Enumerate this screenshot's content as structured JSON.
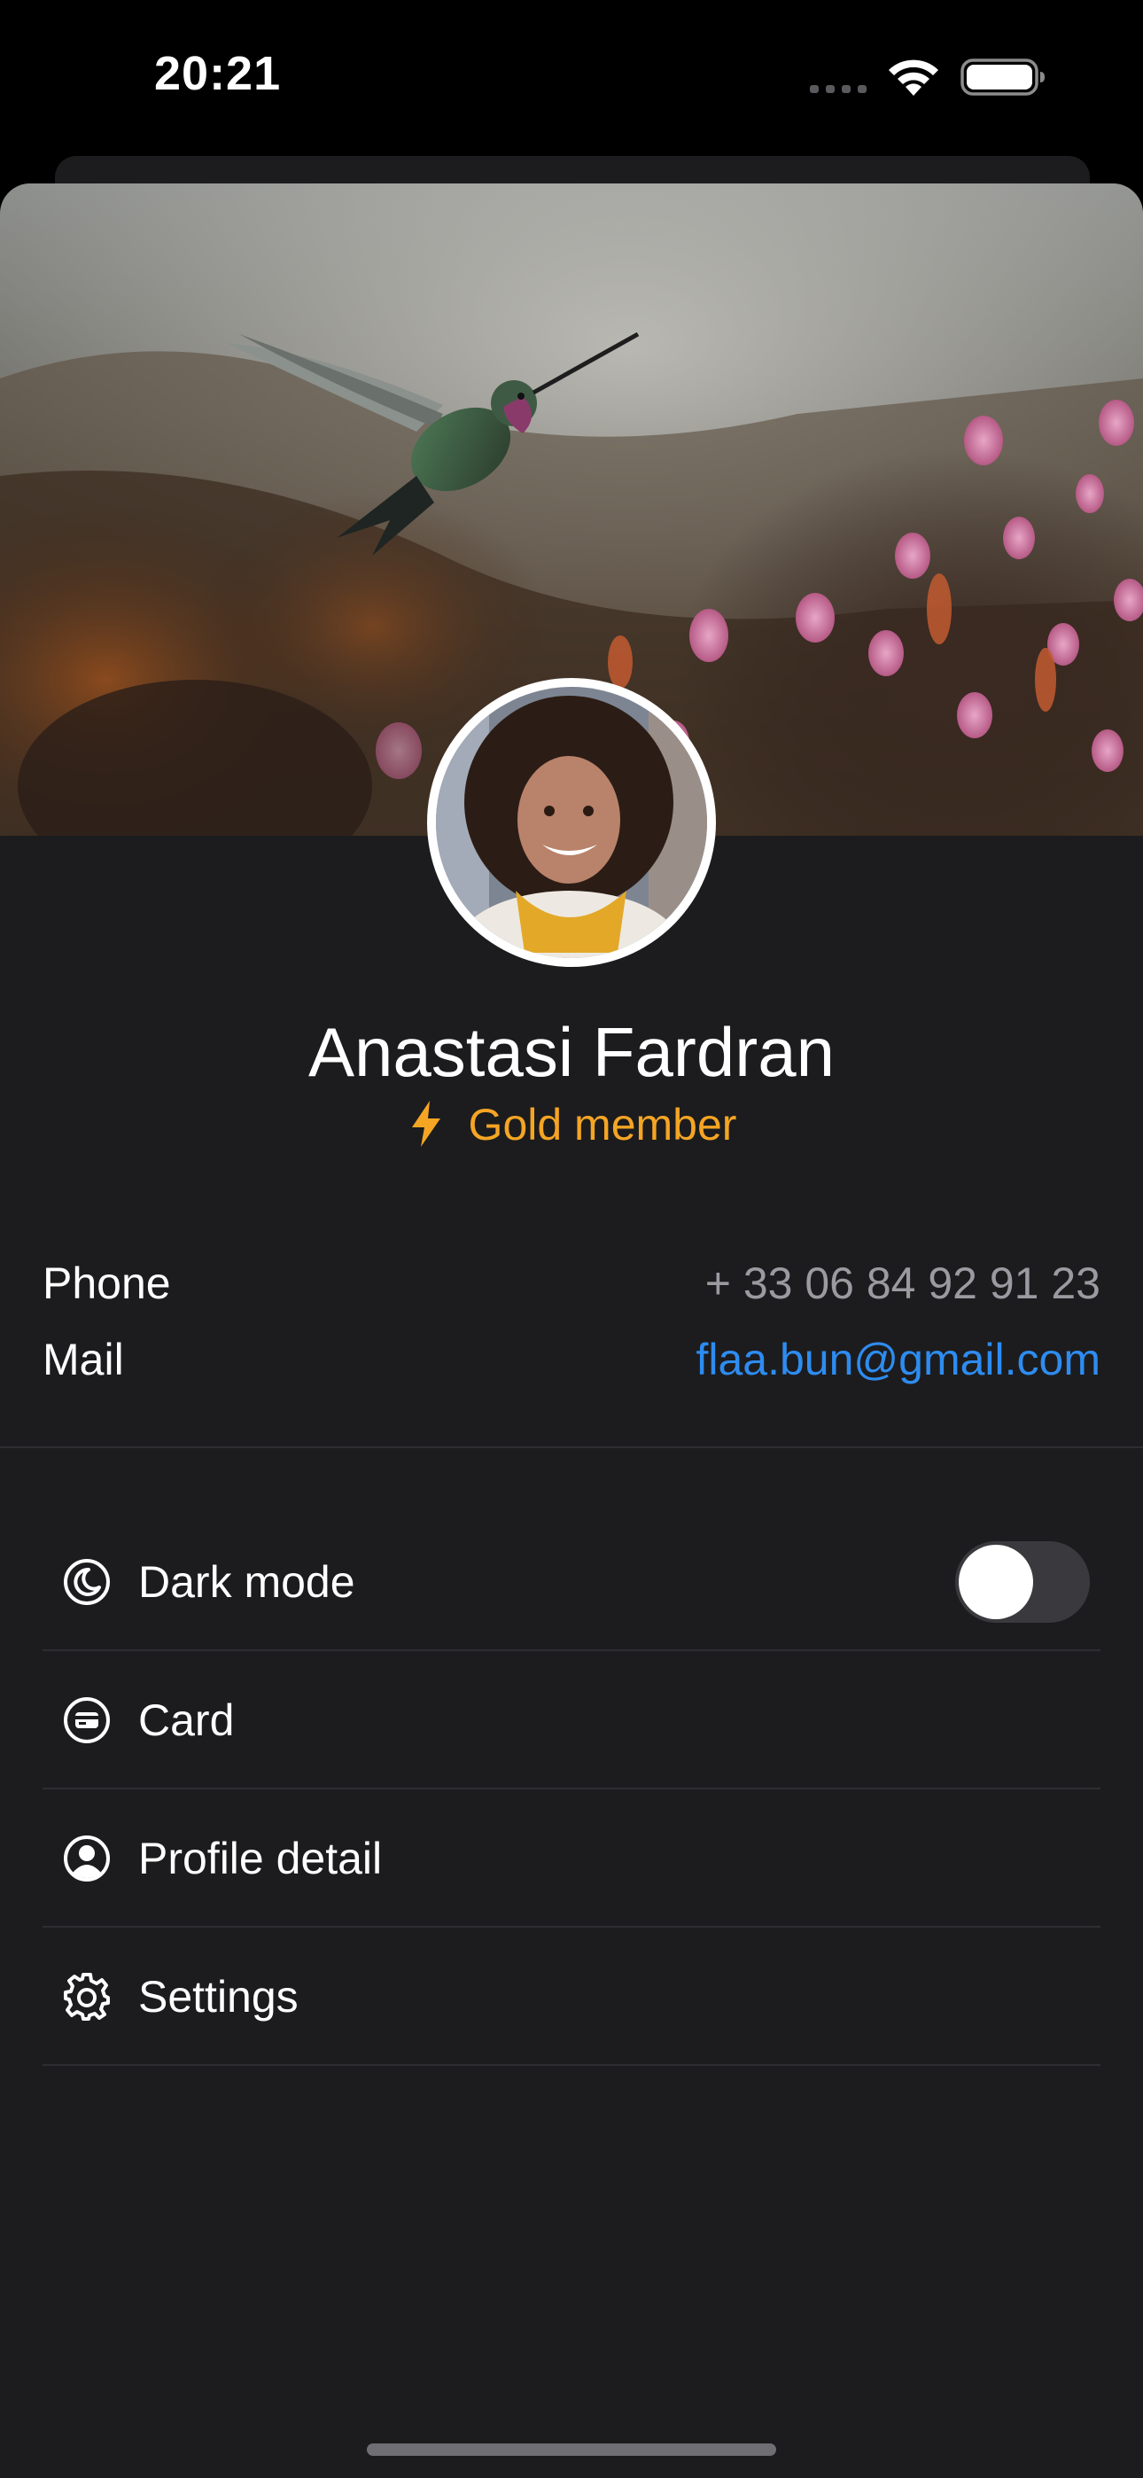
{
  "status_bar": {
    "time": "20:21"
  },
  "profile": {
    "name": "Anastasi Fardran",
    "membership": "Gold member",
    "membership_icon": "lightning-bolt-icon",
    "membership_color": "#f5a524"
  },
  "contact": {
    "phone_label": "Phone",
    "phone_value": "+ 33 06 84 92 91 23",
    "mail_label": "Mail",
    "mail_value": "flaa.bun@gmail.com",
    "mail_color": "#2e8cf0"
  },
  "menu": {
    "items": [
      {
        "label": "Dark mode",
        "icon": "moon-icon",
        "toggle": false
      },
      {
        "label": "Card",
        "icon": "card-icon"
      },
      {
        "label": "Profile detail",
        "icon": "user-circle-icon"
      },
      {
        "label": "Settings",
        "icon": "gear-icon"
      }
    ]
  },
  "theme": {
    "background": "#000000",
    "sheet": "#1c1c1e",
    "separator": "#2e2e32"
  }
}
